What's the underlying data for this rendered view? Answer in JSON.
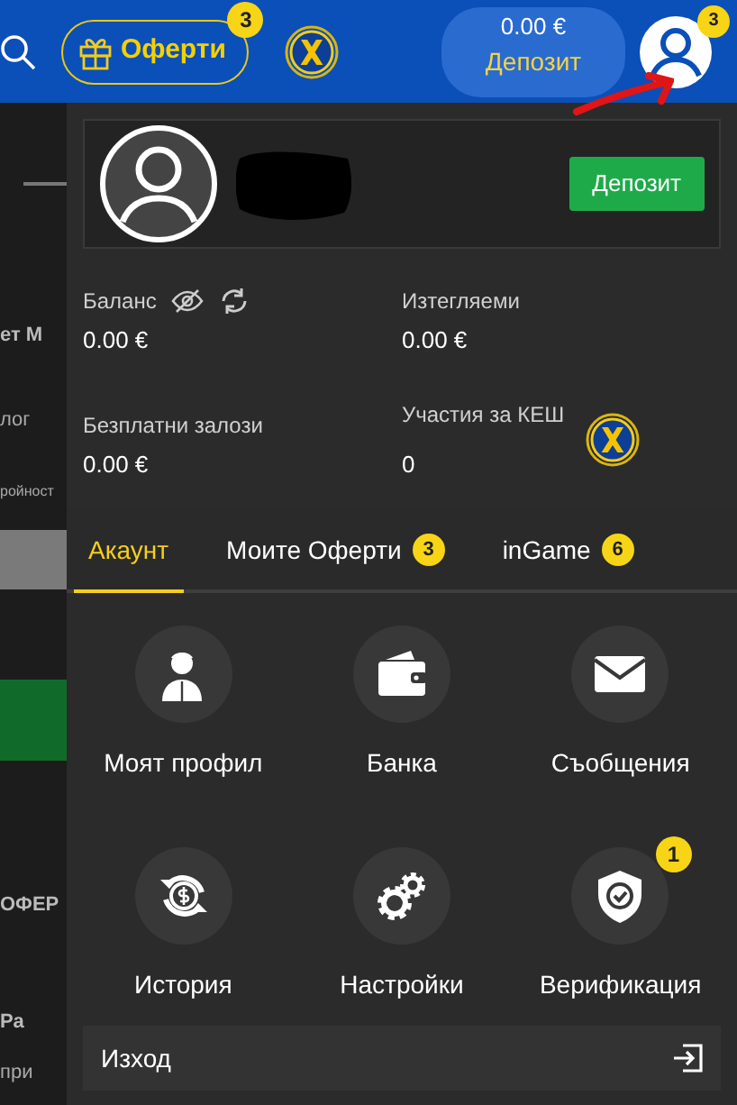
{
  "header": {
    "offers_label": "Оферти",
    "offers_count": "3",
    "balance": "0.00 €",
    "deposit": "Депозит",
    "profile_count": "3"
  },
  "background_page": [
    {
      "text": "ет М",
      "kind": "heading"
    },
    {
      "text": "лог",
      "kind": "plain"
    },
    {
      "text": "ройност",
      "kind": "small"
    },
    {
      "text": "ОФЕР",
      "kind": "heading"
    },
    {
      "text": "Ра",
      "kind": "heading"
    },
    {
      "text": "при",
      "kind": "plain"
    }
  ],
  "profile": {
    "deposit_button": "Депозит"
  },
  "stats": [
    {
      "label": "Баланс",
      "value": "0.00 €",
      "kind": "balance"
    },
    {
      "label": "Изтегляеми",
      "value": "0.00 €",
      "kind": "plain"
    },
    {
      "label": "Безплатни залози",
      "value": "0.00 €",
      "kind": "plain"
    },
    {
      "label": "Участия за КЕШ",
      "value": "0",
      "kind": "cash"
    }
  ],
  "tabs": [
    {
      "label": "Акаунт",
      "selected": true
    },
    {
      "label": "Моите Оферти",
      "count": "3",
      "selected": false
    },
    {
      "label": "inGame",
      "count": "6",
      "selected": false
    }
  ],
  "menu": [
    {
      "label": "Моят профил",
      "kind": "profile"
    },
    {
      "label": "Банка",
      "kind": "wallet"
    },
    {
      "label": "Съобщения",
      "kind": "mail"
    },
    {
      "label": "История",
      "kind": "history"
    },
    {
      "label": "Настройки",
      "kind": "settings"
    },
    {
      "label": "Верификация",
      "kind": "verify",
      "count": "1"
    }
  ],
  "logout": "Изход"
}
